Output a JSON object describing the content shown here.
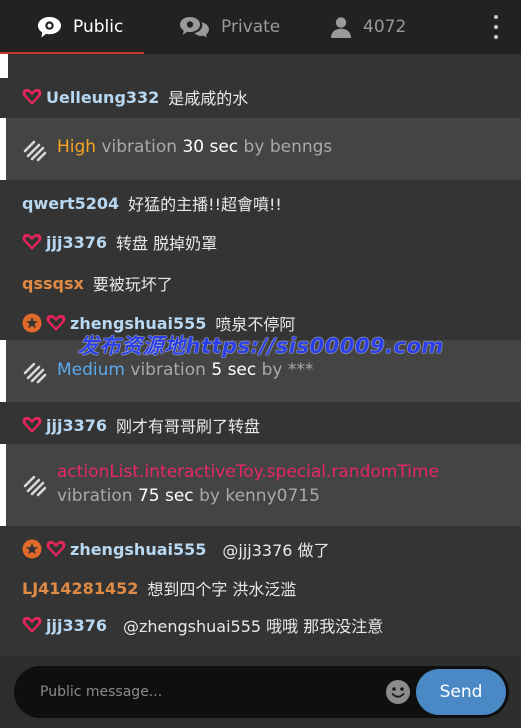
{
  "tabs": {
    "public": {
      "label": "Public",
      "icon": "chat-bubble-icon"
    },
    "private": {
      "label": "Private",
      "icon": "chat-bubbles-icon"
    },
    "users": {
      "label": "4072",
      "icon": "user-icon"
    },
    "menu_icon": "more-vertical-icon"
  },
  "colors": {
    "level_high": "#f5a623",
    "level_medium": "#5aa9ea",
    "level_special": "#e8246c",
    "username_blue": "#b8d7f0",
    "username_orange": "#e08a44",
    "heart_badge": "#e8245c",
    "star_badge": "#e06a2a",
    "send_button": "#4a89c6"
  },
  "messages": [
    {
      "user": "Uelleung332",
      "text": "是咸咸的水",
      "badges": [
        "heart"
      ]
    },
    {
      "type": "vibration",
      "level": "High",
      "word": "vibration",
      "duration": "30 sec",
      "by": "by",
      "who": "benngs"
    },
    {
      "user": "qwert5204",
      "text": "好猛的主播!!超會噴!!",
      "badges": []
    },
    {
      "user": "jjj3376",
      "text": "转盘 脱掉奶罩",
      "badges": [
        "heart"
      ]
    },
    {
      "user": "qssqsx",
      "text": "要被玩坏了",
      "badges": []
    },
    {
      "user": "zhengshuai555",
      "text": "喷泉不停阿",
      "badges": [
        "star",
        "heart"
      ]
    },
    {
      "type": "vibration",
      "level": "Medium",
      "word": "vibration",
      "duration": "5 sec",
      "by": "by",
      "who": "***"
    },
    {
      "user": "jjj3376",
      "text": "刚才有哥哥刷了转盘",
      "badges": [
        "heart"
      ]
    },
    {
      "type": "vibration",
      "level": "actionList.interactiveToy.special.randomTime",
      "word": "vibration",
      "duration": "75 sec",
      "by": "by",
      "who": "kenny0715"
    },
    {
      "user": "zhengshuai555",
      "text": "@jjj3376  做了",
      "badges": [
        "star",
        "heart"
      ]
    },
    {
      "user": "LJ414281452",
      "text": "想到四个字 洪水泛滥",
      "badges": []
    },
    {
      "user": "jjj3376",
      "text": "@zhengshuai555  哦哦 那我没注意",
      "badges": [
        "heart"
      ]
    }
  ],
  "watermark": "发布资源地https://sis00009.com",
  "composer": {
    "placeholder": "Public message...",
    "emoji_icon": "emoji-smiley-icon",
    "send_label": "Send"
  }
}
